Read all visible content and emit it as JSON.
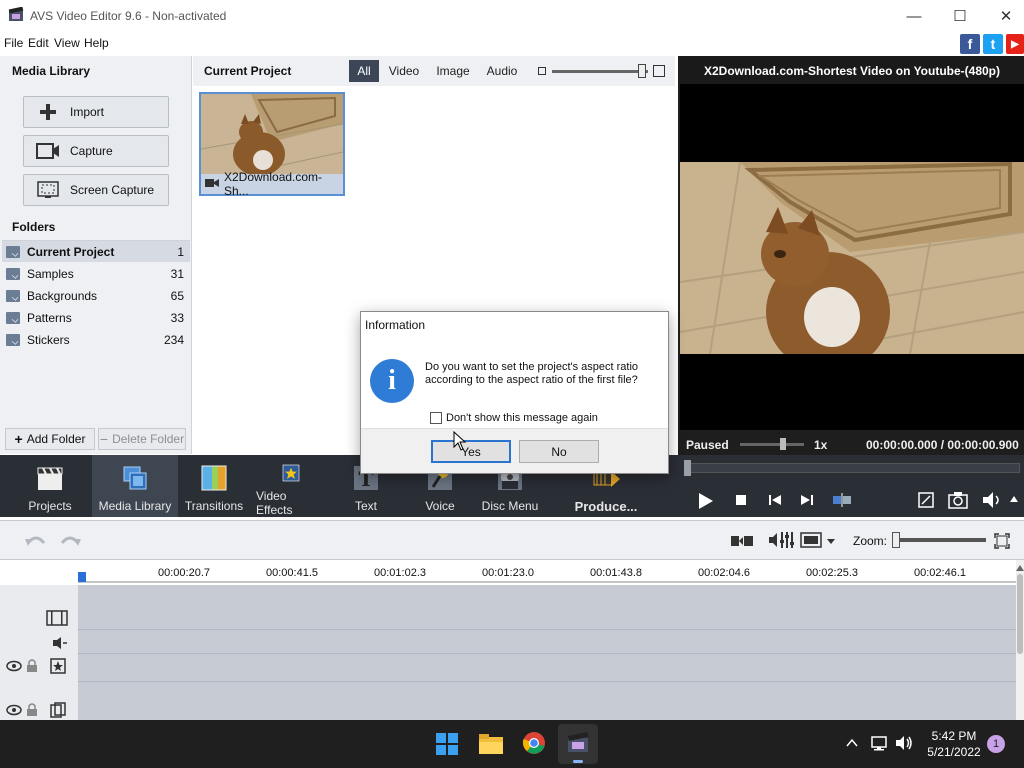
{
  "window": {
    "title": "AVS Video Editor 9.6 - Non-activated",
    "minimize": "—",
    "maximize": "☐",
    "close": "✕"
  },
  "menu": [
    "File",
    "Edit",
    "View",
    "Help"
  ],
  "social": {
    "facebook": "f",
    "twitter": "t",
    "youtube": "▶"
  },
  "media_library": {
    "title": "Media Library",
    "buttons": [
      {
        "label": "Import",
        "icon": "plus-icon"
      },
      {
        "label": "Capture",
        "icon": "camera-icon"
      },
      {
        "label": "Screen Capture",
        "icon": "screen-capture-icon"
      }
    ]
  },
  "folders": {
    "title": "Folders",
    "items": [
      {
        "name": "Current Project",
        "count": "1"
      },
      {
        "name": "Samples",
        "count": "31"
      },
      {
        "name": "Backgrounds",
        "count": "65"
      },
      {
        "name": "Patterns",
        "count": "33"
      },
      {
        "name": "Stickers",
        "count": "234"
      }
    ],
    "add_label": "Add Folder",
    "delete_label": "Delete Folder"
  },
  "current_project": {
    "title": "Current Project",
    "filters": [
      "All",
      "Video",
      "Image",
      "Audio"
    ],
    "thumbnail_label": "X2Download.com-Sh..."
  },
  "preview": {
    "title": "X2Download.com-Shortest Video on Youtube-(480p)",
    "status": "Paused",
    "speed": "1x",
    "timecode": "00:00:00.000 / 00:00:00.900"
  },
  "toolbar": [
    {
      "label": "Projects",
      "icon": "clapperboard-icon"
    },
    {
      "label": "Media Library",
      "icon": "media-library-icon"
    },
    {
      "label": "Transitions",
      "icon": "transitions-icon"
    },
    {
      "label": "Video Effects",
      "icon": "video-effects-icon"
    },
    {
      "label": "Text",
      "icon": "text-icon"
    },
    {
      "label": "Voice",
      "icon": "microphone-icon"
    },
    {
      "label": "Disc Menu",
      "icon": "disc-menu-icon"
    },
    {
      "label": "Produce...",
      "icon": "produce-icon"
    }
  ],
  "timeline": {
    "zoom_label": "Zoom:",
    "ruler": [
      "00:00:20.7",
      "00:00:41.5",
      "00:01:02.3",
      "00:01:23.0",
      "00:01:43.8",
      "00:02:04.6",
      "00:02:25.3",
      "00:02:46.1"
    ]
  },
  "dialog": {
    "title": "Information",
    "message": "Do you want to set the project's aspect ratio according to the aspect ratio of the first file?",
    "checkbox_label": "Don't show this message again",
    "yes_label": "Yes",
    "no_label": "No"
  },
  "taskbar": {
    "time": "5:42 PM",
    "date": "5/21/2022",
    "notification_count": "1"
  }
}
